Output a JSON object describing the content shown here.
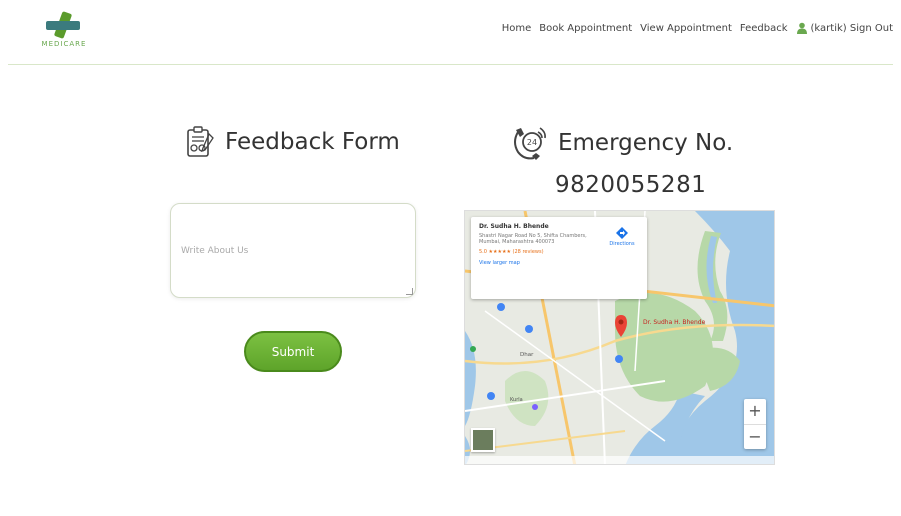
{
  "header": {
    "logo_text": "MEDICARE",
    "nav": {
      "home": "Home",
      "book": "Book Appointment",
      "view": "View Appointment",
      "feedback": "Feedback",
      "user": "(kartik)",
      "signout": "Sign Out"
    }
  },
  "feedback": {
    "title": "Feedback Form",
    "placeholder": "Write About Us",
    "submit_label": "Submit"
  },
  "emergency": {
    "title": "Emergency No.",
    "number": "9820055281"
  },
  "map": {
    "place_name": "Dr. Sudha H. Bhende",
    "address": "Shastri Nagar Road No 5, Shifta Chambers, Mumbai, Maharashtra 400073",
    "rating": "5.0 ★★★★★  (28 reviews)",
    "link": "View larger map",
    "directions": "Directions",
    "pin_label": "Dr. Sudha H. Bhende",
    "zoom_in": "+",
    "zoom_out": "−"
  },
  "colors": {
    "accent": "#6aa84f",
    "button": "#6cb335",
    "water": "#9fc7e8",
    "land": "#e8eae3",
    "park": "#b7d8a8"
  }
}
